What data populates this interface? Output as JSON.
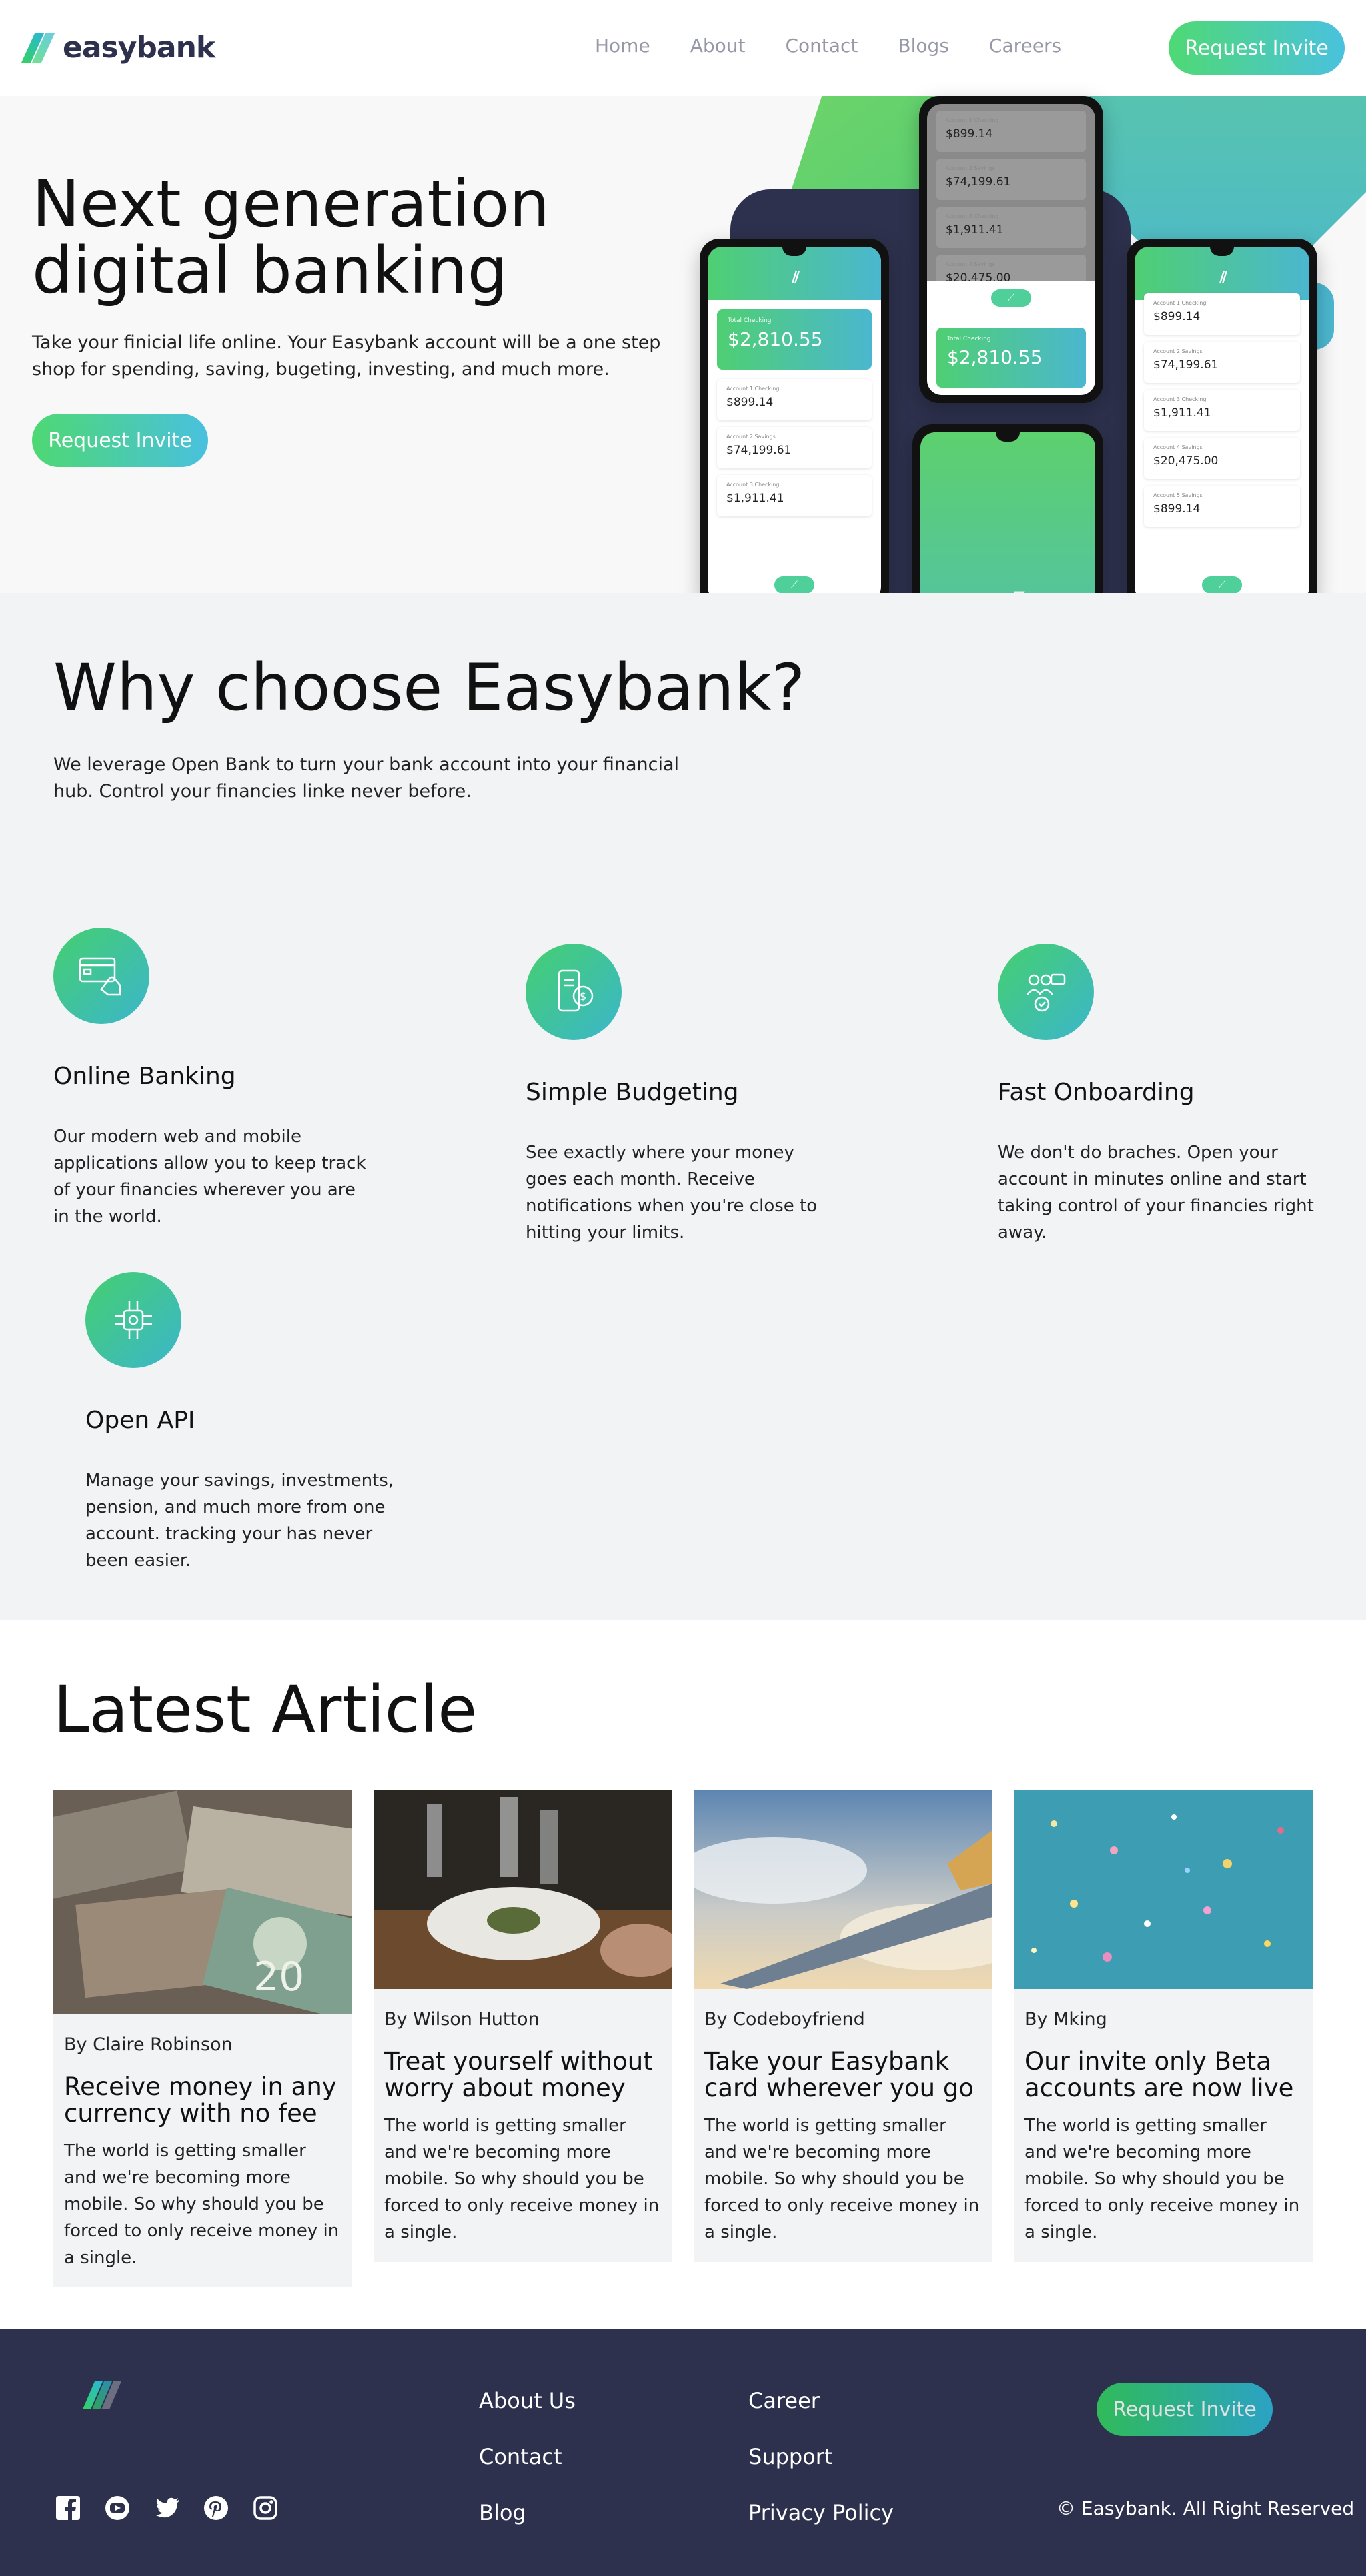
{
  "nav": {
    "logo": "easybank",
    "links": [
      "Home",
      "About",
      "Contact",
      "Blogs",
      "Careers"
    ],
    "cta": "Request Invite"
  },
  "hero": {
    "title_line1": "Next generation",
    "title_line2": "digital banking",
    "text": "Take your finicial life online. Your Easybank account will be a one step shop for spending, saving, bugeting, investing, and much more.",
    "cta": "Request Invite"
  },
  "phones": {
    "total_label": "Total Checking",
    "total": "$2,810.55",
    "accounts": [
      {
        "label": "Account 1 Checking",
        "amount": "$899.14"
      },
      {
        "label": "Account 2 Savings",
        "amount": "$74,199.61"
      },
      {
        "label": "Account 3 Checking",
        "amount": "$1,911.41"
      },
      {
        "label": "Account 4 Savings",
        "amount": "$20,475.00"
      },
      {
        "label": "Account 5 Savings",
        "amount": "$899.14"
      }
    ]
  },
  "why": {
    "title": "Why choose Easybank?",
    "text": "We leverage Open Bank to turn your bank account into your financial hub. Control your financies linke never before.",
    "features": [
      {
        "title": "Online Banking",
        "text": "Our modern web and mobile applications allow you to keep track of your financies wherever you are in the world.",
        "icon": "credit-card-icon"
      },
      {
        "title": "Simple Budgeting",
        "text": "See exactly where your money goes each month. Receive notifications when you're close to hitting your limits.",
        "icon": "budget-phone-icon"
      },
      {
        "title": "Fast Onboarding",
        "text": "We don't do braches. Open your account in minutes online and start taking control of your financies right away.",
        "icon": "onboarding-icon"
      },
      {
        "title": "Open API",
        "text": "Manage your savings, investments, pension, and much more from one account. tracking your has never been easier.",
        "icon": "api-chip-icon"
      }
    ]
  },
  "articles": {
    "title": "Latest Article",
    "items": [
      {
        "author": "By Claire Robinson",
        "title": "Receive money in any currency with no fee",
        "text": "The world is getting smaller and we're becoming more mobile. So why should you be forced to only receive money in a single."
      },
      {
        "author": "By Wilson Hutton",
        "title": "Treat yourself without worry about money",
        "text": "The world is getting smaller and we're becoming more mobile. So why should you be forced to only receive money in a single."
      },
      {
        "author": "By Codeboyfriend",
        "title": "Take your Easybank card wherever you go",
        "text": "The world is getting smaller and we're becoming more mobile. So why should you be forced to only receive money in a single."
      },
      {
        "author": "By Mking",
        "title": "Our invite only Beta accounts are now live",
        "text": "The world is getting smaller and we're becoming more mobile. So why should you be forced to only receive money in a single."
      }
    ]
  },
  "footer": {
    "col1": [
      "About Us",
      "Contact",
      "Blog"
    ],
    "col2": [
      "Career",
      "Support",
      "Privacy Policy"
    ],
    "cta": "Request Invite",
    "copyright": "© Easybank. All Right Reserved",
    "social": [
      "facebook-icon",
      "youtube-icon",
      "twitter-icon",
      "pinterest-icon",
      "instagram-icon"
    ]
  },
  "colors": {
    "dark_blue": "#2d314d",
    "green": "#31d35c",
    "cyan": "#2bb7da",
    "light_bg": "#f2f3f5"
  }
}
